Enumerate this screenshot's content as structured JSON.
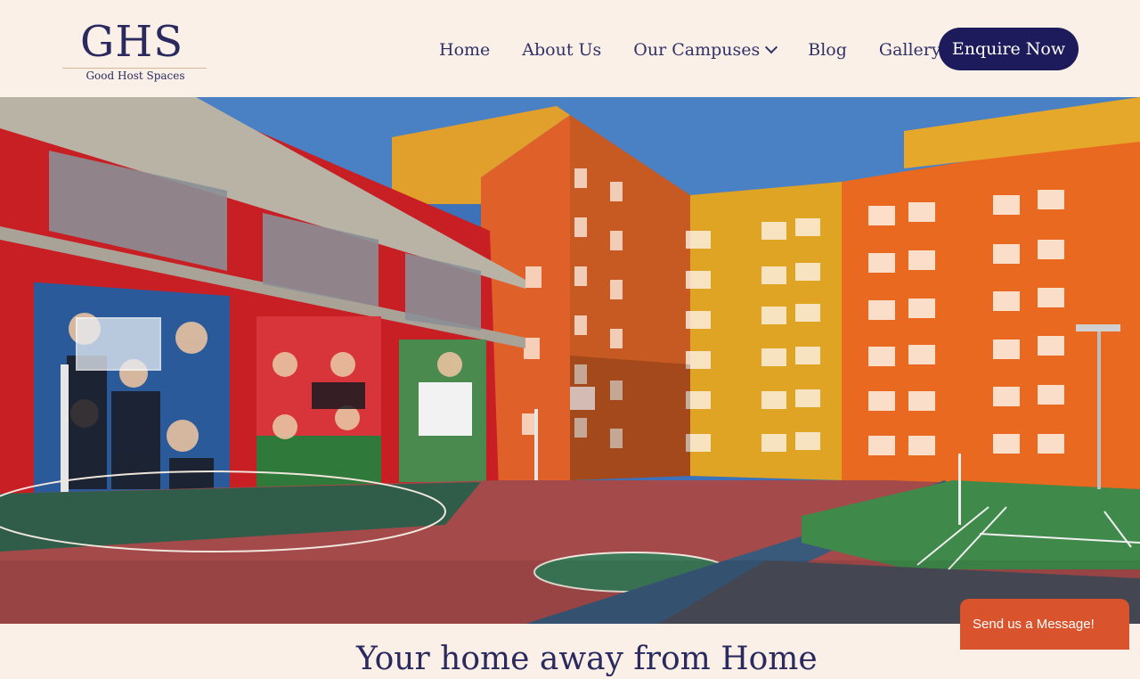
{
  "brand": {
    "logo_text": "GHS",
    "tagline": "Good Host Spaces"
  },
  "nav": {
    "items": [
      {
        "label": "Home"
      },
      {
        "label": "About Us"
      },
      {
        "label": "Our Campuses"
      },
      {
        "label": "Blog"
      },
      {
        "label": "Gallery"
      }
    ],
    "cta_label": "Enquire Now"
  },
  "hero": {
    "slides_total": 4,
    "active_slide": 1
  },
  "chat": {
    "label": "Send us a Message!"
  },
  "section": {
    "heading": "Your home away from Home"
  },
  "colors": {
    "background": "#fbf0e8",
    "primary": "#1d1b5c",
    "nav_text": "#2f3266",
    "chat_button": "#d9542d"
  }
}
